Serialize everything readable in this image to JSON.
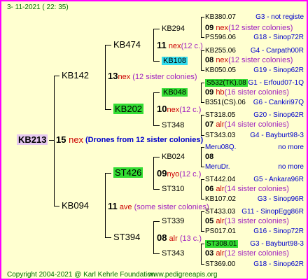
{
  "header": {
    "date": "3- 11-2021 ( 22: 35)"
  },
  "footer": {
    "copyright": "Copyright 2004-2021 @ Karl Kehrle Foundation",
    "site": "www.pedigreeapis.org"
  },
  "colors": {
    "frame": "#ff00ff",
    "background": "#ffffd0",
    "highlight_green": "#33dd33",
    "highlight_cyan": "#33ddee",
    "red": "#cc0000",
    "blue": "#0000cc"
  },
  "root": {
    "id": "KB213",
    "num": "15",
    "type": "nex",
    "desc": "(Drones from 12 sister colonies)"
  },
  "gen1": [
    {
      "id": "KB142",
      "num": "13",
      "type": "nex",
      "desc": "(12 sister colonies)"
    },
    {
      "id": "KB094",
      "num": "11",
      "type": "ave",
      "desc": "(some sister colonies)"
    }
  ],
  "gen2": [
    {
      "id": "KB474",
      "num": "11",
      "type": "nex",
      "desc": "(12 c.)"
    },
    {
      "id": "KB202",
      "num": "10",
      "type": "nex",
      "desc": "(12 c.)"
    },
    {
      "id": "ST426",
      "num": "09",
      "type": "nyo",
      "desc": "(12 c.)"
    },
    {
      "id": "ST394",
      "num": "08",
      "type": "alr",
      "desc": "(13 c.)"
    }
  ],
  "gen3": [
    {
      "id": "KB294"
    },
    {
      "id": "KB108",
      "num": "08",
      "type": "nex",
      "desc": "(12 sister colonies)"
    },
    {
      "id": "KB048",
      "num": "09",
      "type": "hb",
      "desc": "(16 sister colonies)"
    },
    {
      "id": "ST348",
      "num": "07",
      "type": "alr",
      "desc": "(14 sister colonies)"
    },
    {
      "id": "KB024",
      "num": "08"
    },
    {
      "id": "ST310",
      "num": "06",
      "type": "alr",
      "desc": "(14 sister colonies)"
    },
    {
      "id": "ST339",
      "num": "05",
      "type": "alr",
      "desc": "(13 sister colonies)"
    },
    {
      "id": "ST343",
      "num": "03",
      "type": "alr",
      "desc": "(12 sister colonies)"
    }
  ],
  "gen3_top": {
    "num": "09",
    "type": "nex",
    "desc": "(12 sister colonies)"
  },
  "gen4": [
    {
      "id": "KB380.07",
      "loc": "G3 - not registe"
    },
    {
      "id": "PS596.06",
      "loc": "G18 - Sinop72R"
    },
    {
      "id": "KB255.06",
      "loc": "G4 - Carpath00R"
    },
    {
      "id": "KB050.05",
      "loc": "G19 - Sinop62R"
    },
    {
      "id": "S532(TK).08",
      "loc": "G1 - Erfoud07-1Q"
    },
    {
      "id": "B351(CS).06",
      "loc": "G6 - Cankiri97Q"
    },
    {
      "id": "ST318.05",
      "loc": "G20 - Sinop62R"
    },
    {
      "id": "ST343.03",
      "loc": "G4 - Bayburt98-3"
    },
    {
      "id": "Meru08Q.",
      "loc": "no more"
    },
    {
      "id": "MeruDr.",
      "loc": "no more"
    },
    {
      "id": "ST442.04",
      "loc": "G5 - Ankara96R"
    },
    {
      "id": "KB107.02",
      "loc": "G3 - Sinop96R"
    },
    {
      "id": "ST433.03",
      "loc": "G11 - SinopEgg86R"
    },
    {
      "id": "PS017.01",
      "loc": "G16 - Sinop72R"
    },
    {
      "id": "ST308.01",
      "loc": "G3 - Bayburt98-3"
    },
    {
      "id": "ST369.00",
      "loc": "G18 - Sinop62R"
    }
  ]
}
